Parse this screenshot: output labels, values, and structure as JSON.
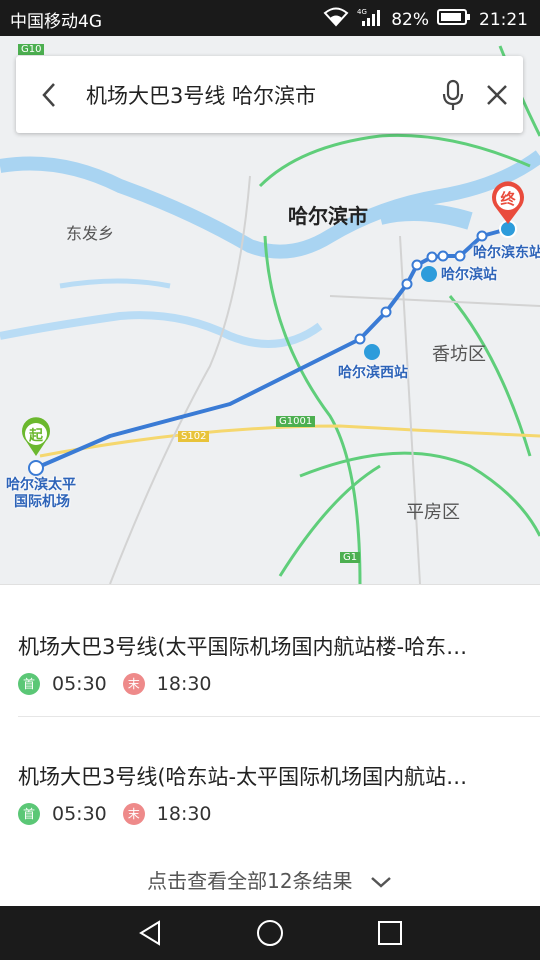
{
  "status_bar": {
    "carrier": "中国移动4G",
    "network": "4G",
    "battery": "82%",
    "time": "21:21"
  },
  "search": {
    "query": "机场大巴3号线 哈尔滨市"
  },
  "map": {
    "city_label": "哈尔滨市",
    "area_labels": [
      "东发乡",
      "香坊区",
      "平房区"
    ],
    "road_labels": [
      "G10",
      "G1001",
      "S102",
      "G1"
    ],
    "stations": {
      "start": "哈尔滨太平国际机场",
      "start_line1": "哈尔滨太平",
      "start_line2": "国际机场",
      "west": "哈尔滨西站",
      "main": "哈尔滨站",
      "east": "哈尔滨东站"
    },
    "start_marker": "起",
    "end_marker": "终",
    "route_color": "#3a7bd5"
  },
  "results": [
    {
      "title": "机场大巴3号线(太平国际机场国内航站楼-哈东…",
      "first_badge": "首",
      "first_time": "05:30",
      "last_badge": "末",
      "last_time": "18:30"
    },
    {
      "title": "机场大巴3号线(哈东站-太平国际机场国内航站…",
      "first_badge": "首",
      "first_time": "05:30",
      "last_badge": "末",
      "last_time": "18:30"
    }
  ],
  "more_label": "点击查看全部12条结果"
}
